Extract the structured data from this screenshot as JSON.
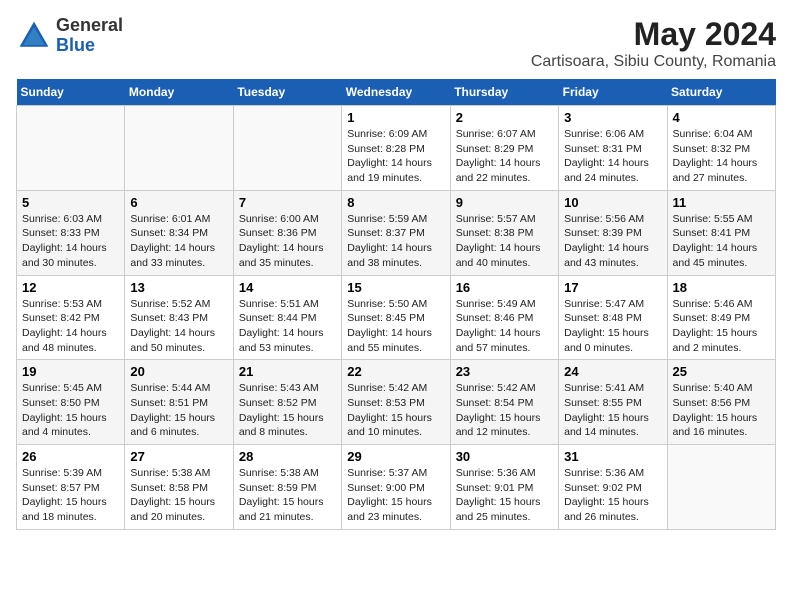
{
  "header": {
    "logo_line1": "General",
    "logo_line2": "Blue",
    "month": "May 2024",
    "location": "Cartisoara, Sibiu County, Romania"
  },
  "weekdays": [
    "Sunday",
    "Monday",
    "Tuesday",
    "Wednesday",
    "Thursday",
    "Friday",
    "Saturday"
  ],
  "weeks": [
    [
      {
        "day": "",
        "sunrise": "",
        "sunset": "",
        "daylight": ""
      },
      {
        "day": "",
        "sunrise": "",
        "sunset": "",
        "daylight": ""
      },
      {
        "day": "",
        "sunrise": "",
        "sunset": "",
        "daylight": ""
      },
      {
        "day": "1",
        "sunrise": "Sunrise: 6:09 AM",
        "sunset": "Sunset: 8:28 PM",
        "daylight": "Daylight: 14 hours and 19 minutes."
      },
      {
        "day": "2",
        "sunrise": "Sunrise: 6:07 AM",
        "sunset": "Sunset: 8:29 PM",
        "daylight": "Daylight: 14 hours and 22 minutes."
      },
      {
        "day": "3",
        "sunrise": "Sunrise: 6:06 AM",
        "sunset": "Sunset: 8:31 PM",
        "daylight": "Daylight: 14 hours and 24 minutes."
      },
      {
        "day": "4",
        "sunrise": "Sunrise: 6:04 AM",
        "sunset": "Sunset: 8:32 PM",
        "daylight": "Daylight: 14 hours and 27 minutes."
      }
    ],
    [
      {
        "day": "5",
        "sunrise": "Sunrise: 6:03 AM",
        "sunset": "Sunset: 8:33 PM",
        "daylight": "Daylight: 14 hours and 30 minutes."
      },
      {
        "day": "6",
        "sunrise": "Sunrise: 6:01 AM",
        "sunset": "Sunset: 8:34 PM",
        "daylight": "Daylight: 14 hours and 33 minutes."
      },
      {
        "day": "7",
        "sunrise": "Sunrise: 6:00 AM",
        "sunset": "Sunset: 8:36 PM",
        "daylight": "Daylight: 14 hours and 35 minutes."
      },
      {
        "day": "8",
        "sunrise": "Sunrise: 5:59 AM",
        "sunset": "Sunset: 8:37 PM",
        "daylight": "Daylight: 14 hours and 38 minutes."
      },
      {
        "day": "9",
        "sunrise": "Sunrise: 5:57 AM",
        "sunset": "Sunset: 8:38 PM",
        "daylight": "Daylight: 14 hours and 40 minutes."
      },
      {
        "day": "10",
        "sunrise": "Sunrise: 5:56 AM",
        "sunset": "Sunset: 8:39 PM",
        "daylight": "Daylight: 14 hours and 43 minutes."
      },
      {
        "day": "11",
        "sunrise": "Sunrise: 5:55 AM",
        "sunset": "Sunset: 8:41 PM",
        "daylight": "Daylight: 14 hours and 45 minutes."
      }
    ],
    [
      {
        "day": "12",
        "sunrise": "Sunrise: 5:53 AM",
        "sunset": "Sunset: 8:42 PM",
        "daylight": "Daylight: 14 hours and 48 minutes."
      },
      {
        "day": "13",
        "sunrise": "Sunrise: 5:52 AM",
        "sunset": "Sunset: 8:43 PM",
        "daylight": "Daylight: 14 hours and 50 minutes."
      },
      {
        "day": "14",
        "sunrise": "Sunrise: 5:51 AM",
        "sunset": "Sunset: 8:44 PM",
        "daylight": "Daylight: 14 hours and 53 minutes."
      },
      {
        "day": "15",
        "sunrise": "Sunrise: 5:50 AM",
        "sunset": "Sunset: 8:45 PM",
        "daylight": "Daylight: 14 hours and 55 minutes."
      },
      {
        "day": "16",
        "sunrise": "Sunrise: 5:49 AM",
        "sunset": "Sunset: 8:46 PM",
        "daylight": "Daylight: 14 hours and 57 minutes."
      },
      {
        "day": "17",
        "sunrise": "Sunrise: 5:47 AM",
        "sunset": "Sunset: 8:48 PM",
        "daylight": "Daylight: 15 hours and 0 minutes."
      },
      {
        "day": "18",
        "sunrise": "Sunrise: 5:46 AM",
        "sunset": "Sunset: 8:49 PM",
        "daylight": "Daylight: 15 hours and 2 minutes."
      }
    ],
    [
      {
        "day": "19",
        "sunrise": "Sunrise: 5:45 AM",
        "sunset": "Sunset: 8:50 PM",
        "daylight": "Daylight: 15 hours and 4 minutes."
      },
      {
        "day": "20",
        "sunrise": "Sunrise: 5:44 AM",
        "sunset": "Sunset: 8:51 PM",
        "daylight": "Daylight: 15 hours and 6 minutes."
      },
      {
        "day": "21",
        "sunrise": "Sunrise: 5:43 AM",
        "sunset": "Sunset: 8:52 PM",
        "daylight": "Daylight: 15 hours and 8 minutes."
      },
      {
        "day": "22",
        "sunrise": "Sunrise: 5:42 AM",
        "sunset": "Sunset: 8:53 PM",
        "daylight": "Daylight: 15 hours and 10 minutes."
      },
      {
        "day": "23",
        "sunrise": "Sunrise: 5:42 AM",
        "sunset": "Sunset: 8:54 PM",
        "daylight": "Daylight: 15 hours and 12 minutes."
      },
      {
        "day": "24",
        "sunrise": "Sunrise: 5:41 AM",
        "sunset": "Sunset: 8:55 PM",
        "daylight": "Daylight: 15 hours and 14 minutes."
      },
      {
        "day": "25",
        "sunrise": "Sunrise: 5:40 AM",
        "sunset": "Sunset: 8:56 PM",
        "daylight": "Daylight: 15 hours and 16 minutes."
      }
    ],
    [
      {
        "day": "26",
        "sunrise": "Sunrise: 5:39 AM",
        "sunset": "Sunset: 8:57 PM",
        "daylight": "Daylight: 15 hours and 18 minutes."
      },
      {
        "day": "27",
        "sunrise": "Sunrise: 5:38 AM",
        "sunset": "Sunset: 8:58 PM",
        "daylight": "Daylight: 15 hours and 20 minutes."
      },
      {
        "day": "28",
        "sunrise": "Sunrise: 5:38 AM",
        "sunset": "Sunset: 8:59 PM",
        "daylight": "Daylight: 15 hours and 21 minutes."
      },
      {
        "day": "29",
        "sunrise": "Sunrise: 5:37 AM",
        "sunset": "Sunset: 9:00 PM",
        "daylight": "Daylight: 15 hours and 23 minutes."
      },
      {
        "day": "30",
        "sunrise": "Sunrise: 5:36 AM",
        "sunset": "Sunset: 9:01 PM",
        "daylight": "Daylight: 15 hours and 25 minutes."
      },
      {
        "day": "31",
        "sunrise": "Sunrise: 5:36 AM",
        "sunset": "Sunset: 9:02 PM",
        "daylight": "Daylight: 15 hours and 26 minutes."
      },
      {
        "day": "",
        "sunrise": "",
        "sunset": "",
        "daylight": ""
      }
    ]
  ]
}
